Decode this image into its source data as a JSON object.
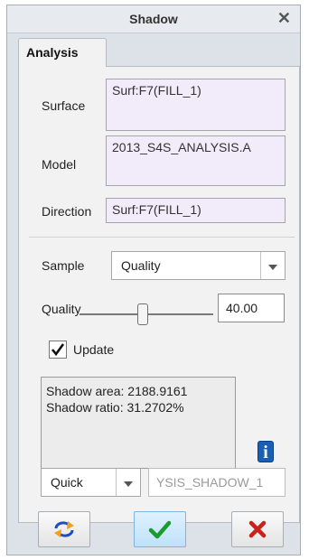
{
  "window": {
    "title": "Shadow",
    "close_icon": "close-icon"
  },
  "tab": {
    "label": "Analysis"
  },
  "fields": {
    "surface": {
      "label": "Surface",
      "value": "Surf:F7(FILL_1)"
    },
    "model": {
      "label": "Model",
      "value": "2013_S4S_ANALYSIS.A"
    },
    "direction": {
      "label": "Direction",
      "value": "Surf:F7(FILL_1)"
    }
  },
  "sample": {
    "label": "Sample",
    "selected": "Quality"
  },
  "quality": {
    "label": "Quality",
    "value": "40.00"
  },
  "update": {
    "label": "Update",
    "checked": true
  },
  "results": {
    "area": "Shadow area: 2188.9161",
    "ratio": "Shadow ratio: 31.2702%"
  },
  "mode": {
    "selected": "Quick"
  },
  "output_name": {
    "value": "YSIS_SHADOW_1"
  },
  "buttons": {
    "repeat_icon": "repeat-icon",
    "ok_icon": "checkmark-icon",
    "cancel_icon": "cancel-x-icon"
  },
  "colors": {
    "ok_green": "#1a9b2e",
    "cancel_red": "#c8221b",
    "info_blue": "#1a5fb4",
    "field_lavender": "#f2ebfa"
  }
}
